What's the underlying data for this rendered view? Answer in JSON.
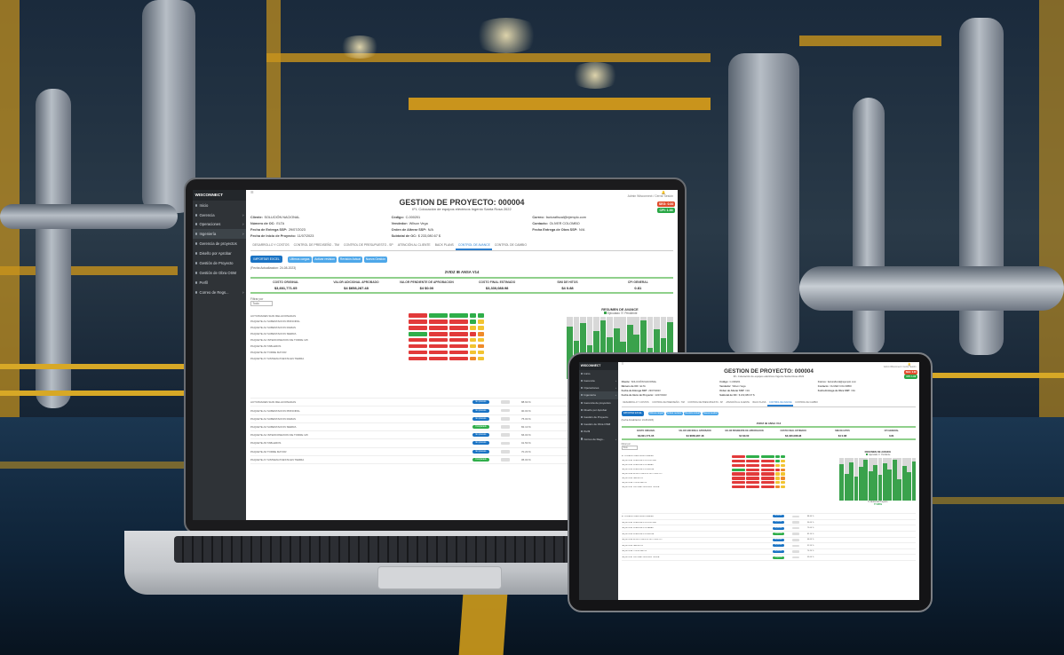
{
  "app": {
    "brand": "WISCONNECT",
    "title": "GESTION DE PROYECTO: 000004",
    "subtitle": "IFI- Colocación de equipos eléctricos Ingenio Santa Rosa 2022",
    "user_menu": "Admin Wisconnect / Cerrar Sesión",
    "badges": [
      {
        "text": "SEG: 0.00",
        "color": "#e04b2b"
      },
      {
        "text": "CPI: 1.00",
        "color": "#28a745"
      }
    ],
    "sidebar": [
      {
        "label": "Inicio",
        "arrow": false
      },
      {
        "label": "Gerencia",
        "arrow": true
      },
      {
        "label": "Operaciones",
        "arrow": true
      },
      {
        "label": "Ingeniería",
        "arrow": true
      },
      {
        "label": "Gerencia de proyectos",
        "arrow": false
      },
      {
        "label": "Diseño por Aprobar",
        "arrow": false
      },
      {
        "label": "Gestión de Proyecto",
        "arrow": false
      },
      {
        "label": "Gestión de Obra OSM",
        "arrow": false
      },
      {
        "label": "Perfil",
        "arrow": false
      },
      {
        "label": "Correo de Regs...",
        "arrow": true
      }
    ],
    "info": [
      {
        "label": "Cliente:",
        "value": "SOLUCIÓN NACIONAL"
      },
      {
        "label": "Código:",
        "value": "C-000201"
      },
      {
        "label": "Correo:",
        "value": "facturafiscal@ejemplo.com"
      },
      {
        "label": "Número de OC:",
        "value": "ELTA"
      },
      {
        "label": "Vendedor:",
        "value": "Wilson Vega"
      },
      {
        "label": "Contacto:",
        "value": "OLIVER COLOMBO"
      },
      {
        "label": "Fecha de Entrega SSP:",
        "value": "29/07/2023"
      },
      {
        "label": "Orden de Alterar SSP:",
        "value": "N/A"
      },
      {
        "label": "Fecha Entrega de Obra SSP:",
        "value": "N/A"
      },
      {
        "label": "Fecha de Inicio de Proyecto:",
        "value": "11/07/2023"
      },
      {
        "label": "Subtotal de OC:",
        "value": "$ 233,080.67 $"
      },
      {
        "label": "",
        "value": ""
      }
    ],
    "tabs": [
      {
        "label": "DESARROLLO Y COSTOS",
        "active": false
      },
      {
        "label": "CONTROL DE PREDISEÑO - TIM",
        "active": false
      },
      {
        "label": "CONTROL DE PRESUPUESTO - SP",
        "active": false
      },
      {
        "label": "ATENCIÓN AL CLIENTE",
        "active": false
      },
      {
        "label": "BACK PLANS",
        "active": false
      },
      {
        "label": "CONTROL DE AVANCE",
        "active": true
      },
      {
        "label": "CONTROL DE CAMBIO",
        "active": false
      }
    ],
    "import_label": "IMPORTAR EXCEL",
    "chips": [
      "Ultimos cargas",
      "Activar revision",
      "Revisión Actual",
      "Nueva Gestión"
    ],
    "update_note": "(Fecha Actualizacion: 24-08-2023)",
    "section_title": "2VIDZ IB ANSA V14",
    "kpis": [
      {
        "label": "COSTO ORIGINAL",
        "value": "$3,601,771.05"
      },
      {
        "label": "VALOR ADICIONAL APROBADO",
        "value": "$4  $658,287.48"
      },
      {
        "label": "VALOR PENDIENTE DE APROBACION",
        "value": "$4  $0.00"
      },
      {
        "label": "COSTO FINAL ESTIMADO",
        "value": "$3,330,088.98"
      },
      {
        "label": "SINI DE HITOS",
        "value": "$4  0.88"
      },
      {
        "label": "CPI GENERAL",
        "value": "0.81"
      }
    ],
    "filter_label": "Filtrar por",
    "filter_value": "Todo",
    "tasks": [
      "ACTIVIDADES SIAN RELACIONADAS",
      "PAQUETE A1 SUBESTACION PRINCIPAL",
      "PAQUETE A2 SUBESTACION RAMAS",
      "PAQUETE A3 SUBESTACION SIERRA",
      "PAQUETE A4 INTERCONEXION DE TORRE 115",
      "PAQUETE A5 TABLEROS",
      "PAQUETE A6 TORRE MAYOR",
      "PAQUETE A7 SISTEMA PUESTA EN TIERRA"
    ],
    "chart": {
      "title": "RESUMEN DE AVANCE",
      "legend": [
        "Ejecutado",
        "Pendiente"
      ],
      "progress_label": "% Global del Proyecto",
      "progress_value": "77.88%",
      "values": [
        0.85,
        0.62,
        0.9,
        0.55,
        0.78,
        0.95,
        0.68,
        0.82,
        0.6,
        0.88,
        0.72,
        0.95,
        0.5,
        0.8,
        0.66,
        0.92
      ]
    },
    "list_rows": [
      "ACTIVIDADES SIAN RELACIONADAS",
      "PAQUETE A1 SUBESTACION PRINCIPAL",
      "PAQUETE A2 SUBESTACION RAMAS",
      "PAQUETE A3 SUBESTACION SIERRA",
      "PAQUETE A4 INTERCONEXION DE TORRE 115",
      "PAQUETE A5 TABLEROS",
      "PAQUETE A6 TORRE MAYOR",
      "PAQUETE A7 SISTEMA PUESTA EN TIERRA"
    ],
    "list_status": [
      "En proceso",
      "Completado"
    ],
    "list_pcts": [
      "88.60 %",
      "90.00 %",
      "75.00 %",
      "82.10 %",
      "66.00 %",
      "91.50 %",
      "70.20 %",
      "95.00 %"
    ]
  }
}
